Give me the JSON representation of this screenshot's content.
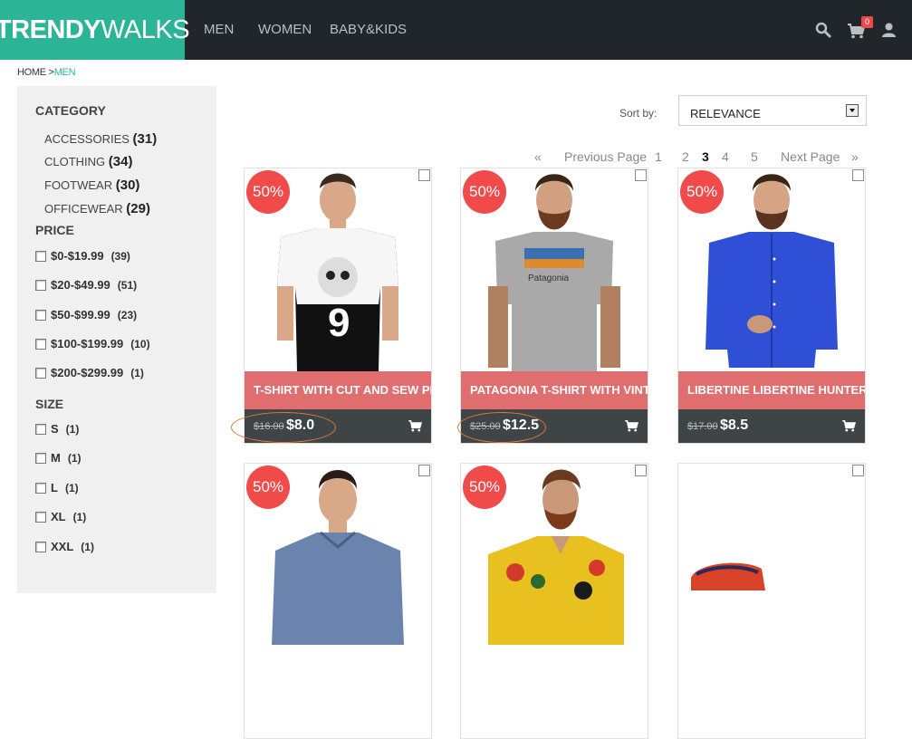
{
  "header": {
    "logo_bold": "TRENDY",
    "logo_light": "WALKS",
    "nav": [
      "MEN",
      "WOMEN",
      "BABY&KIDS"
    ],
    "cart_count": "0",
    "colors": {
      "brand": "#2bb596",
      "bar": "#20262a",
      "accent_red": "#f04a4a"
    }
  },
  "breadcrumb": {
    "home": "HOME >",
    "current": "MEN"
  },
  "sidebar": {
    "category_title": "CATEGORY",
    "categories": [
      {
        "label": "ACCESSORIES",
        "count": "(31)"
      },
      {
        "label": "CLOTHING",
        "count": "(34)"
      },
      {
        "label": "FOOTWEAR",
        "count": "(30)"
      },
      {
        "label": "OFFICEWEAR",
        "count": "(29)"
      }
    ],
    "price_title": "PRICE",
    "prices": [
      {
        "label": "$0-$19.99",
        "count": "(39)"
      },
      {
        "label": "$20-$49.99",
        "count": "(51)"
      },
      {
        "label": "$50-$99.99",
        "count": "(23)"
      },
      {
        "label": "$100-$199.99",
        "count": "(10)"
      },
      {
        "label": "$200-$299.99",
        "count": "(1)"
      }
    ],
    "size_title": "SIZE",
    "sizes": [
      {
        "label": "S",
        "count": "(1)"
      },
      {
        "label": "M",
        "count": "(1)"
      },
      {
        "label": "L",
        "count": "(1)"
      },
      {
        "label": "XL",
        "count": "(1)"
      },
      {
        "label": "XXL",
        "count": "(1)"
      }
    ]
  },
  "sort": {
    "label": "Sort by:",
    "value": "RELEVANCE"
  },
  "pagination": {
    "first": "«",
    "prev": "Previous Page",
    "pages": [
      "1",
      "2",
      "3",
      "4",
      "5"
    ],
    "current": "3",
    "next": "Next Page",
    "last": "»"
  },
  "products": [
    {
      "badge": "50%",
      "title": "T-SHIRT WITH CUT AND SEW PRINT",
      "old_price": "$16.00",
      "new_price": "$8.0"
    },
    {
      "badge": "50%",
      "title": "PATAGONIA T-SHIRT WITH VINTA...",
      "old_price": "$25.00",
      "new_price": "$12.5"
    },
    {
      "badge": "50%",
      "title": "LIBERTINE LIBERTINE HUNTER SH...",
      "old_price": "$17.00",
      "new_price": "$8.5"
    },
    {
      "badge": "50%"
    },
    {
      "badge": "50%"
    },
    {}
  ]
}
